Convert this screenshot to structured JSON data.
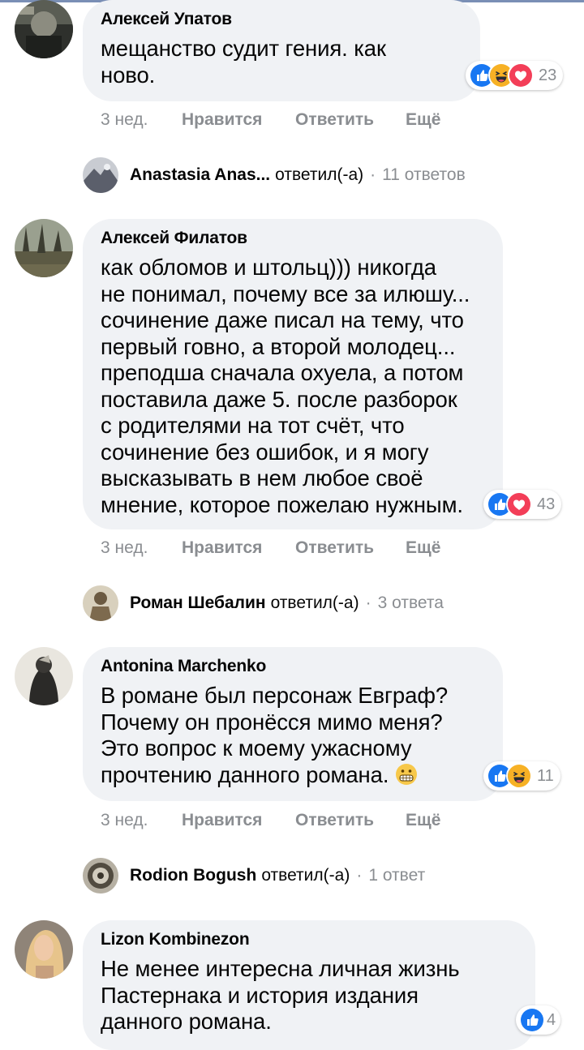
{
  "comments": [
    {
      "author": "Алексей Упатов",
      "text_lines": [
        "мещанство судит гения. как",
        "ново."
      ],
      "reactions": {
        "icons": [
          "like-icon",
          "haha-icon",
          "love-icon"
        ],
        "count": "23"
      },
      "actions": {
        "time": "3 нед.",
        "like": "Нравится",
        "reply": "Ответить",
        "more": "Ещё"
      },
      "reply_summary": {
        "name": "Anastasia Anas...",
        "verb": "ответил(-а)",
        "dot": "·",
        "count": "11 ответов"
      }
    },
    {
      "author": "Алексей Филатов",
      "text_lines": [
        "как обломов и штольц))) никогда",
        "не понимал, почему все за илюшу...",
        "сочинение даже писал на тему, что",
        "первый говно, а второй молодец...",
        "преподша сначала охуела, а потом",
        "поставила даже 5. после разборок",
        "с родителями на тот счёт, что",
        "сочинение без ошибок, и я могу",
        "высказывать в нем любое своё",
        "мнение, которое пожелаю нужным."
      ],
      "reactions": {
        "icons": [
          "like-icon",
          "love-icon"
        ],
        "count": "43"
      },
      "actions": {
        "time": "3 нед.",
        "like": "Нравится",
        "reply": "Ответить",
        "more": "Ещё"
      },
      "reply_summary": {
        "name": "Роман Шебалин",
        "verb": "ответил(-а)",
        "dot": "·",
        "count": "3 ответа"
      }
    },
    {
      "author": "Antonina Marchenko",
      "text_lines": [
        "В романе был персонаж Евграф?",
        "Почему он пронёсся мимо меня?",
        "Это вопрос к моему ужасному",
        "прочтению данного романа."
      ],
      "emoji": "grimacing-emoji",
      "reactions": {
        "icons": [
          "like-icon",
          "haha-icon"
        ],
        "count": "11"
      },
      "actions": {
        "time": "3 нед.",
        "like": "Нравится",
        "reply": "Ответить",
        "more": "Ещё"
      },
      "reply_summary": {
        "name": "Rodion Bogush",
        "verb": "ответил(-а)",
        "dot": "·",
        "count": "1 ответ"
      }
    },
    {
      "author": "Lizon Kombinezon",
      "text_lines": [
        "Не менее интересна личная жизнь",
        "Пастернака и история издания",
        "данного романа."
      ],
      "reactions": {
        "icons": [
          "like-icon"
        ],
        "count": "4"
      }
    }
  ],
  "colors": {
    "bubble": "#f0f2f5",
    "text": "#050505",
    "secondary": "#8a8d91",
    "like_blue": "#1877f2",
    "love_red": "#f33e58",
    "haha_yellow": "#f7b125"
  }
}
